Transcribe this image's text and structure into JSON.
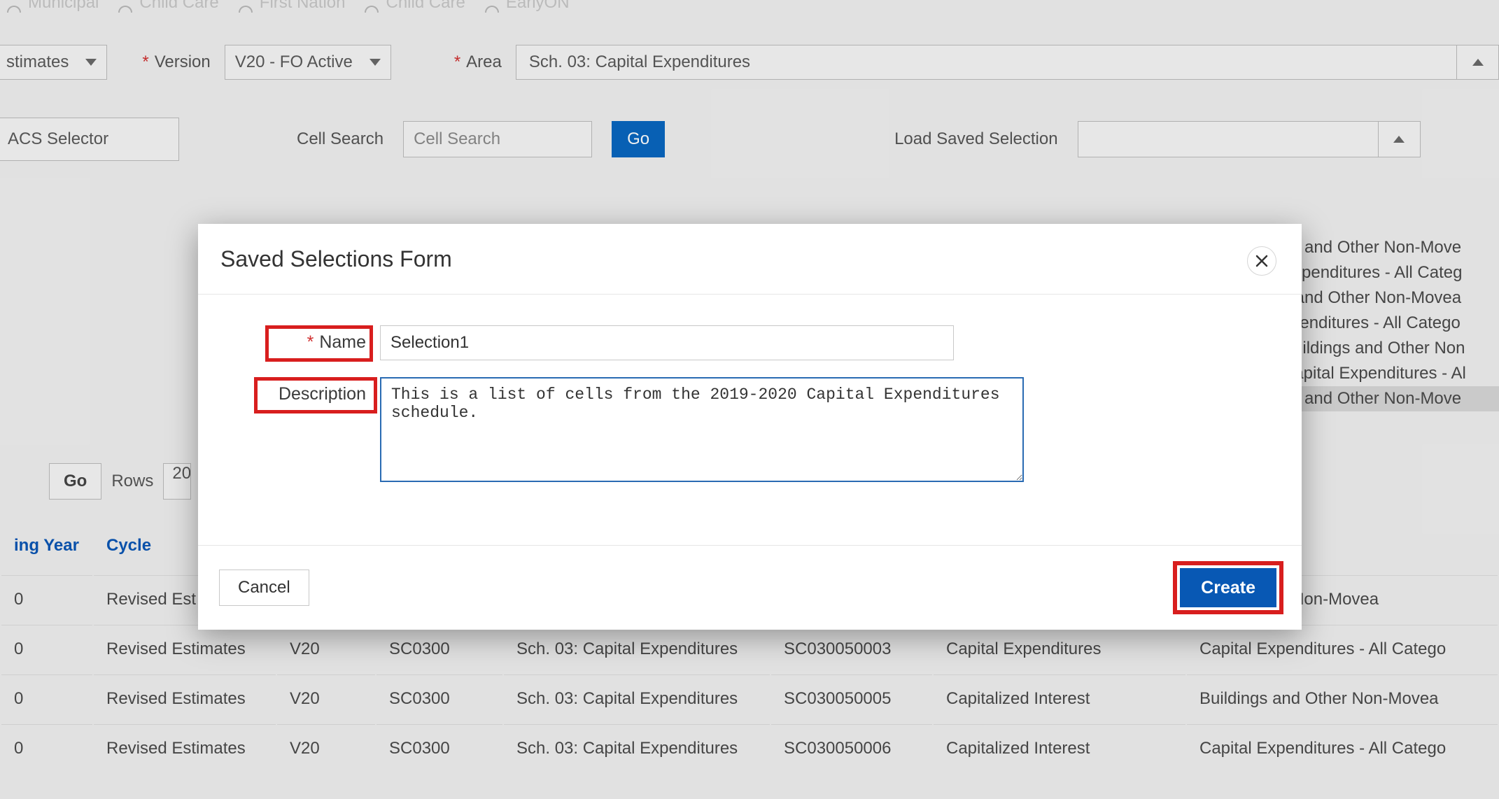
{
  "filters": {
    "estimates_label": "stimates",
    "version_label": "Version",
    "version_value": "V20 - FO Active",
    "area_label": "Area",
    "area_value": "Sch. 03: Capital Expenditures"
  },
  "row2": {
    "acs_selector": "ACS Selector",
    "cell_search_label": "Cell Search",
    "cell_search_placeholder": "Cell Search",
    "go": "Go",
    "load_saved_label": "Load Saved Selection"
  },
  "controls": {
    "go": "Go",
    "rows_label": "Rows",
    "rows_value": "20"
  },
  "radios": {
    "r1": "Municipal",
    "r2": "Child Care",
    "r3": "First Nation",
    "r4": "Child Care",
    "r5": "EarlyON"
  },
  "table": {
    "headers": {
      "year": "ing Year",
      "cycle": "Cycle",
      "version": "",
      "code": "",
      "schedule": "",
      "cell": "",
      "category": "",
      "desc": ""
    },
    "rows": [
      {
        "year": "0",
        "cycle": "Revised Est",
        "version": "",
        "code": "",
        "schedule": "",
        "cell": "",
        "category": "",
        "desc": "s and Other Non-Movea"
      },
      {
        "year": "0",
        "cycle": "Revised Estimates",
        "version": "V20",
        "code": "SC0300",
        "schedule": "Sch. 03: Capital Expenditures",
        "cell": "SC030050003",
        "category": "Capital Expenditures",
        "desc": "Capital Expenditures - All Catego"
      },
      {
        "year": "0",
        "cycle": "Revised Estimates",
        "version": "V20",
        "code": "SC0300",
        "schedule": "Sch. 03: Capital Expenditures",
        "cell": "SC030050005",
        "category": "Capitalized Interest",
        "desc": "Buildings and Other Non-Movea"
      },
      {
        "year": "0",
        "cycle": "Revised Estimates",
        "version": "V20",
        "code": "SC0300",
        "schedule": "Sch. 03: Capital Expenditures",
        "cell": "SC030050006",
        "category": "Capitalized Interest",
        "desc": "Capital Expenditures - All Catego"
      }
    ]
  },
  "right_stack": [
    "gs and Other Non-Move",
    "Expenditures - All Categ",
    "s and Other Non-Movea",
    "xpenditures - All Catego",
    "Buildings and Other Non",
    "Capital Expenditures - Al",
    "gs and Other Non-Move"
  ],
  "modal": {
    "title": "Saved Selections Form",
    "name_label": "Name",
    "name_value": "Selection1",
    "desc_label": "Description",
    "desc_value": "This is a list of cells from the 2019-2020 Capital Expenditures schedule.",
    "cancel": "Cancel",
    "create": "Create"
  }
}
